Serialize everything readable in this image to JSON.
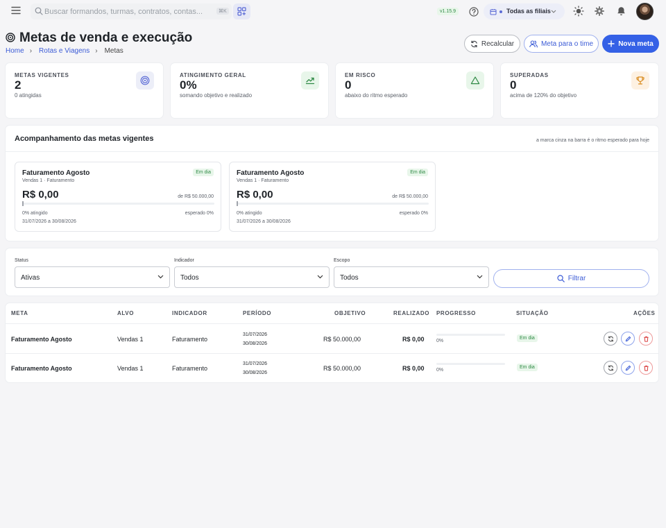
{
  "topbar": {
    "search_placeholder": "Buscar formandos, turmas, contratos, contas...",
    "search_shortcut": "⌘K",
    "version": "v1.15.9",
    "branch": "Todas as filiais"
  },
  "page": {
    "title": "Metas de venda e execução",
    "breadcrumb": [
      "Home",
      "Rotas e Viagens",
      "Metas"
    ]
  },
  "actions": {
    "recalc": "Recalcular",
    "team_goal": "Meta para o time",
    "new_goal": "Nova meta"
  },
  "kpis": [
    {
      "label": "METAS VIGENTES",
      "value": "2",
      "sub": "0 atingidas",
      "icon": "target-icon",
      "color": "#5b6bd6",
      "bg": "#eceef8"
    },
    {
      "label": "ATINGIMENTO GERAL",
      "value": "0%",
      "sub": "somando objetivo e realizado",
      "icon": "trend-icon",
      "color": "#2f8a45",
      "bg": "#e8f6ea"
    },
    {
      "label": "EM RISCO",
      "value": "0",
      "sub": "abaixo do ritmo esperado",
      "icon": "warning-icon",
      "color": "#2f8a45",
      "bg": "#e8f6ea"
    },
    {
      "label": "SUPERADAS",
      "value": "0",
      "sub": "acima de 120% do objetivo",
      "icon": "trophy-icon",
      "color": "#d98b1e",
      "bg": "#fdf1e2"
    }
  ],
  "tracking": {
    "title": "Acompanhamento das metas vigentes",
    "hint": "a marca cinza na barra é o ritmo esperado para hoje",
    "cards": [
      {
        "name": "Faturamento Agosto",
        "meta": "Vendas 1 · Faturamento",
        "badge": "Em dia",
        "value": "R$ 0,00",
        "target": "de R$ 50.000,00",
        "achieved": "0% atingido",
        "expected": "esperado 0%",
        "range": "31/07/2026 a 30/08/2026",
        "progress": 0,
        "expected_pct": 0
      },
      {
        "name": "Faturamento Agosto",
        "meta": "Vendas 1 · Faturamento",
        "badge": "Em dia",
        "value": "R$ 0,00",
        "target": "de R$ 50.000,00",
        "achieved": "0% atingido",
        "expected": "esperado 0%",
        "range": "31/07/2026 a 30/08/2026",
        "progress": 0,
        "expected_pct": 0
      }
    ]
  },
  "filters": {
    "status_label": "Status",
    "status_value": "Ativas",
    "indicator_label": "Indicador",
    "indicator_value": "Todos",
    "scope_label": "Escopo",
    "scope_value": "Todos",
    "filter_button": "Filtrar"
  },
  "table": {
    "headers": [
      "META",
      "ALVO",
      "INDICADOR",
      "PERÍODO",
      "OBJETIVO",
      "REALIZADO",
      "PROGRESSO",
      "SITUAÇÃO",
      "AÇÕES"
    ],
    "rows": [
      {
        "meta": "Faturamento Agosto",
        "alvo": "Vendas 1",
        "indicador": "Faturamento",
        "period_start": "31/07/2026",
        "period_end": "30/08/2026",
        "objetivo": "R$ 50.000,00",
        "realizado": "R$ 0,00",
        "progress_label": "0%",
        "progress": 0,
        "situacao": "Em dia"
      },
      {
        "meta": "Faturamento Agosto",
        "alvo": "Vendas 1",
        "indicador": "Faturamento",
        "period_start": "31/07/2026",
        "period_end": "30/08/2026",
        "objetivo": "R$ 50.000,00",
        "realizado": "R$ 0,00",
        "progress_label": "0%",
        "progress": 0,
        "situacao": "Em dia"
      }
    ]
  }
}
